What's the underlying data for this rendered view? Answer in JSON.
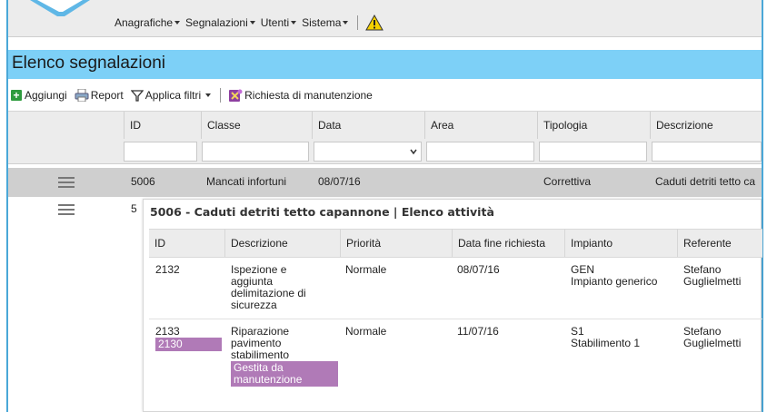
{
  "menu": {
    "items": [
      {
        "label": "Anagrafiche"
      },
      {
        "label": "Segnalazioni"
      },
      {
        "label": "Utenti"
      },
      {
        "label": "Sistema"
      }
    ],
    "warning_icon": "warning-icon"
  },
  "page_title": "Elenco segnalazioni",
  "toolbar": {
    "add_label": "Aggiungi",
    "report_label": "Report",
    "filter_label": "Applica filtri",
    "maintenance_label": "Richiesta di manutenzione"
  },
  "grid": {
    "columns": [
      "ID",
      "Classe",
      "Data",
      "Area",
      "Tipologia",
      "Descrizione"
    ],
    "rows": [
      {
        "id": "5006",
        "classe": "Mancati infortuni",
        "data": "08/07/16",
        "area": "",
        "tipologia": "Correttiva",
        "descrizione": "Caduti detriti tetto ca"
      },
      {
        "id": "5"
      }
    ]
  },
  "sub_panel": {
    "title": "5006 - Caduti detriti tetto capannone | Elenco attività",
    "columns": [
      "ID",
      "Descrizione",
      "Priorità",
      "Data fine richiesta",
      "Impianto",
      "Referente"
    ],
    "rows": [
      {
        "id": "2132",
        "descrizione": [
          "Ispezione e",
          "aggiunta",
          "delimitazione di",
          "sicurezza"
        ],
        "priorita": "Normale",
        "data_fine": "08/07/16",
        "impianto": [
          "GEN",
          "Impianto generico"
        ],
        "referente": [
          "Stefano",
          "Guglielmetti"
        ]
      },
      {
        "id": "2133",
        "id_tag": "2130",
        "descrizione": [
          "Riparazione",
          "pavimento",
          "stabilimento"
        ],
        "descrizione_tag": [
          "Gestita da",
          "manutenzione"
        ],
        "priorita": "Normale",
        "data_fine": "11/07/16",
        "impianto": [
          "S1",
          "Stabilimento 1"
        ],
        "referente": [
          "Stefano",
          "Guglielmetti"
        ]
      }
    ]
  },
  "colors": {
    "frame": "#4aa8d8",
    "title_bar": "#7dd0f7",
    "tag": "#b07ab7",
    "selected_row": "#cfcfcf"
  }
}
